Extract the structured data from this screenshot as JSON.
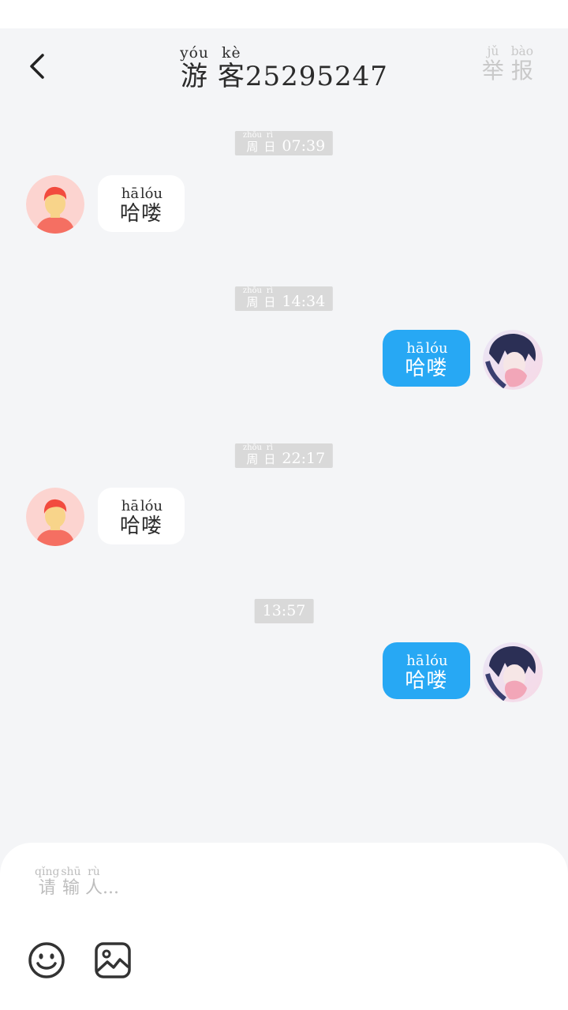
{
  "header": {
    "title_prefix": [
      {
        "base": "游",
        "rt": "yóu"
      },
      {
        "base": "客",
        "rt": "kè"
      }
    ],
    "title_number": "25295247",
    "report": [
      {
        "base": "举",
        "rt": "jǔ"
      },
      {
        "base": "报",
        "rt": "bào"
      }
    ]
  },
  "messages": [
    {
      "time_day": [
        {
          "base": "周",
          "rt": "zhōu"
        },
        {
          "base": "日",
          "rt": "rì"
        }
      ],
      "time": "07:39",
      "direction": "in",
      "text": [
        {
          "base": "哈",
          "rt": "hā"
        },
        {
          "base": "喽",
          "rt": "lóu"
        }
      ]
    },
    {
      "time_day": [
        {
          "base": "周",
          "rt": "zhōu"
        },
        {
          "base": "日",
          "rt": "rì"
        }
      ],
      "time": "14:34",
      "direction": "out",
      "text": [
        {
          "base": "哈",
          "rt": "hā"
        },
        {
          "base": "喽",
          "rt": "lóu"
        }
      ]
    },
    {
      "time_day": [
        {
          "base": "周",
          "rt": "zhōu"
        },
        {
          "base": "日",
          "rt": "rì"
        }
      ],
      "time": "22:17",
      "direction": "in",
      "text": [
        {
          "base": "哈",
          "rt": "hā"
        },
        {
          "base": "喽",
          "rt": "lóu"
        }
      ]
    },
    {
      "time_day": [],
      "time": "13:57",
      "direction": "out",
      "text": [
        {
          "base": "哈",
          "rt": "hā"
        },
        {
          "base": "喽",
          "rt": "lóu"
        }
      ]
    }
  ],
  "composer": {
    "placeholder": [
      {
        "base": "请",
        "rt": "qǐng"
      },
      {
        "base": "输",
        "rt": "shū"
      },
      {
        "base": "人",
        "rt": "rù"
      }
    ],
    "placeholder_suffix": "...",
    "tools": [
      "emoji-icon",
      "image-icon"
    ]
  },
  "colors": {
    "background": "#f4f5f7",
    "outgoing_bubble": "#27a8f4",
    "incoming_bubble": "#ffffff",
    "time_chip": "#d9d9d9"
  }
}
